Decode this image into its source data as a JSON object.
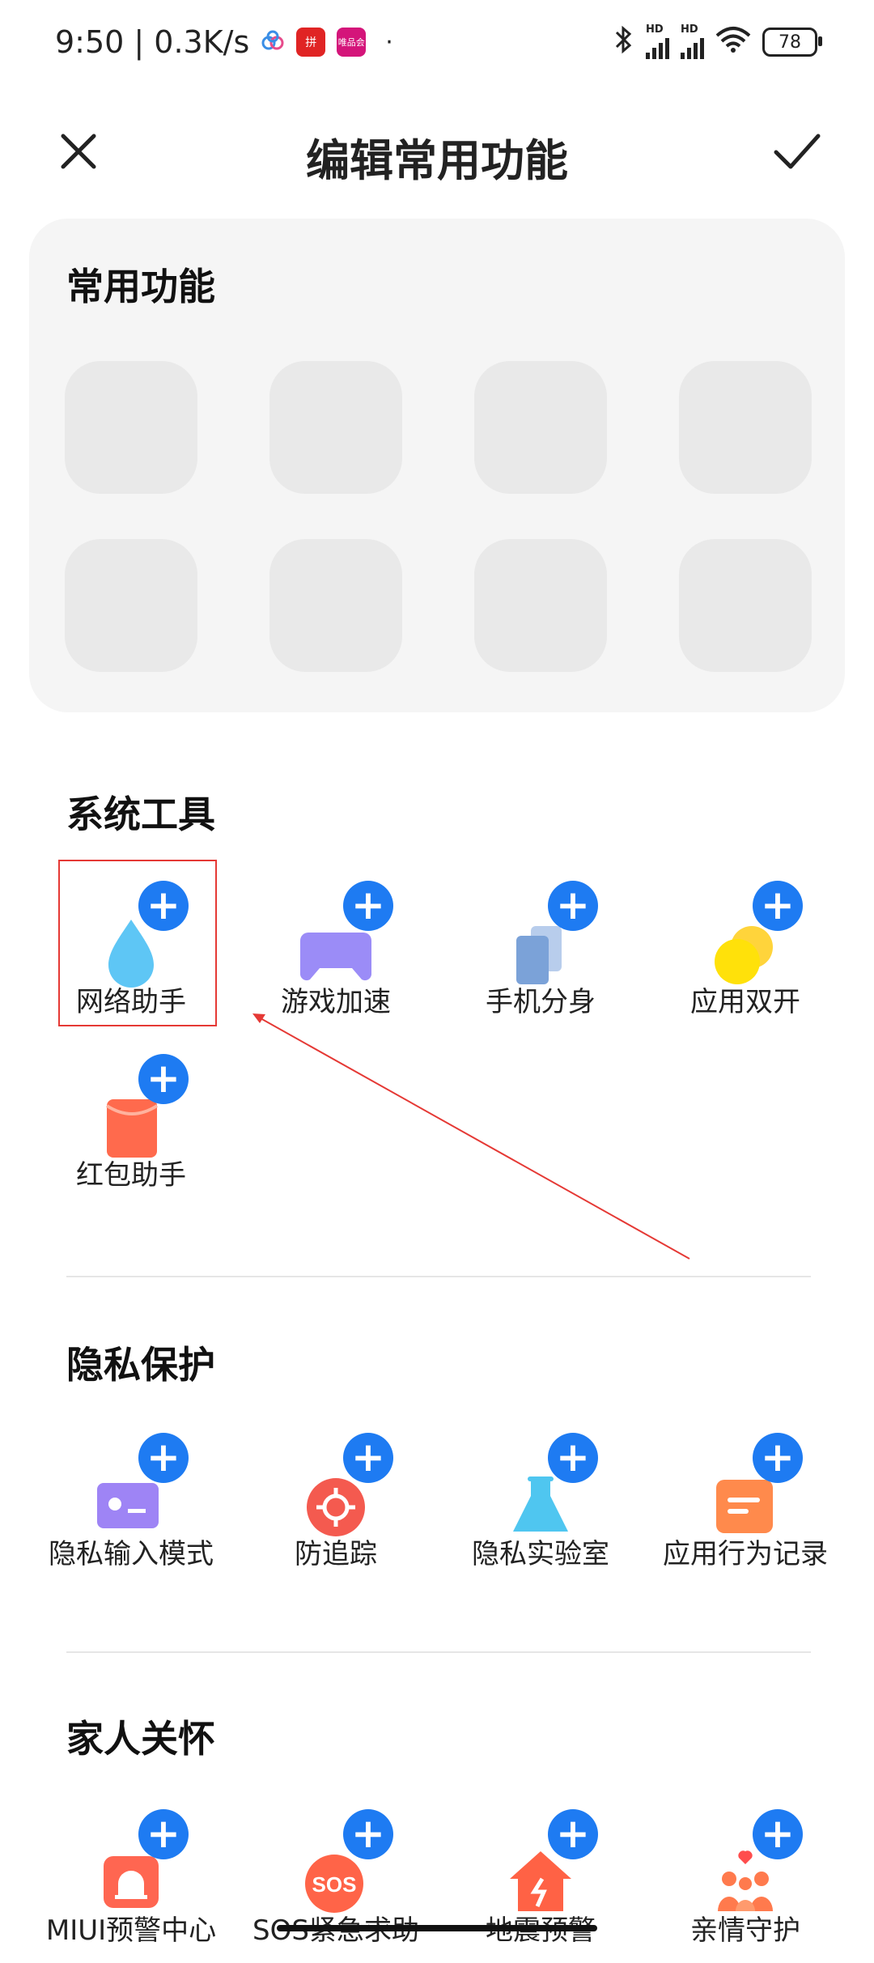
{
  "status_bar": {
    "time_speed": "9:50 | 0.3K/s",
    "badge1": "拼",
    "badge2": "唯品会",
    "dot": "·",
    "hd1": "HD",
    "hd2": "HD",
    "battery": "78"
  },
  "header": {
    "title": "编辑常用功能"
  },
  "favorites": {
    "title": "常用功能"
  },
  "sections": {
    "system_tools": {
      "title": "系统工具",
      "items": [
        {
          "label": "网络助手",
          "icon": "water-drop-icon"
        },
        {
          "label": "游戏加速",
          "icon": "gamepad-icon"
        },
        {
          "label": "手机分身",
          "icon": "dual-phone-icon"
        },
        {
          "label": "应用双开",
          "icon": "dual-circle-icon"
        },
        {
          "label": "红包助手",
          "icon": "red-envelope-icon"
        }
      ]
    },
    "privacy": {
      "title": "隐私保护",
      "items": [
        {
          "label": "隐私输入模式",
          "icon": "keyboard-icon"
        },
        {
          "label": "防追踪",
          "icon": "crosshair-icon"
        },
        {
          "label": "隐私实验室",
          "icon": "flask-icon"
        },
        {
          "label": "应用行为记录",
          "icon": "record-icon"
        }
      ]
    },
    "family": {
      "title": "家人关怀",
      "items": [
        {
          "label": "MIUI预警中心",
          "icon": "alarm-icon"
        },
        {
          "label": "SOS紧急求助",
          "icon": "sos-icon",
          "icon_text": "SOS"
        },
        {
          "label": "地震预警",
          "icon": "house-quake-icon"
        },
        {
          "label": "亲情守护",
          "icon": "family-heart-icon"
        }
      ]
    }
  },
  "plus_glyph": "+",
  "colors": {
    "accent": "#1e7bf2",
    "highlight": "#e53935"
  }
}
